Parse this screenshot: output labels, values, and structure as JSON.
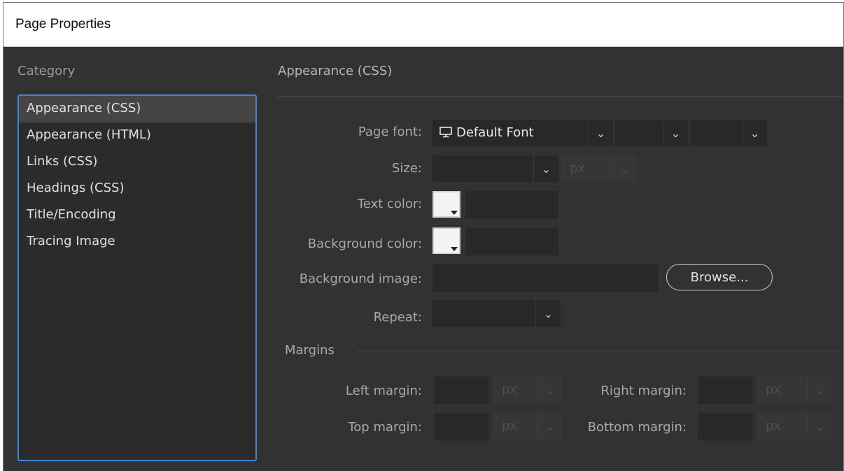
{
  "window": {
    "title": "Page Properties"
  },
  "category": {
    "label": "Category",
    "items": [
      {
        "label": "Appearance (CSS)",
        "selected": true
      },
      {
        "label": "Appearance (HTML)",
        "selected": false
      },
      {
        "label": "Links (CSS)",
        "selected": false
      },
      {
        "label": "Headings (CSS)",
        "selected": false
      },
      {
        "label": "Title/Encoding",
        "selected": false
      },
      {
        "label": "Tracing Image",
        "selected": false
      }
    ]
  },
  "panel": {
    "title": "Appearance (CSS)",
    "page_font": {
      "label": "Page font:",
      "value": "Default Font",
      "icon": "monitor-icon"
    },
    "size": {
      "label": "Size:",
      "value": "",
      "unit": "px"
    },
    "text_color": {
      "label": "Text color:",
      "value": ""
    },
    "background_color": {
      "label": "Background color:",
      "value": ""
    },
    "background_image": {
      "label": "Background image:",
      "value": "",
      "browse_label": "Browse..."
    },
    "repeat": {
      "label": "Repeat:",
      "value": ""
    },
    "margins": {
      "label": "Margins",
      "left": {
        "label": "Left margin:",
        "value": "",
        "unit": "px"
      },
      "right": {
        "label": "Right margin:",
        "value": "",
        "unit": "px"
      },
      "top": {
        "label": "Top margin:",
        "value": "",
        "unit": "px"
      },
      "bottom": {
        "label": "Bottom margin:",
        "value": "",
        "unit": "px"
      }
    }
  },
  "colors": {
    "accent": "#3b87d8",
    "background": "#323232",
    "field": "#282828"
  }
}
